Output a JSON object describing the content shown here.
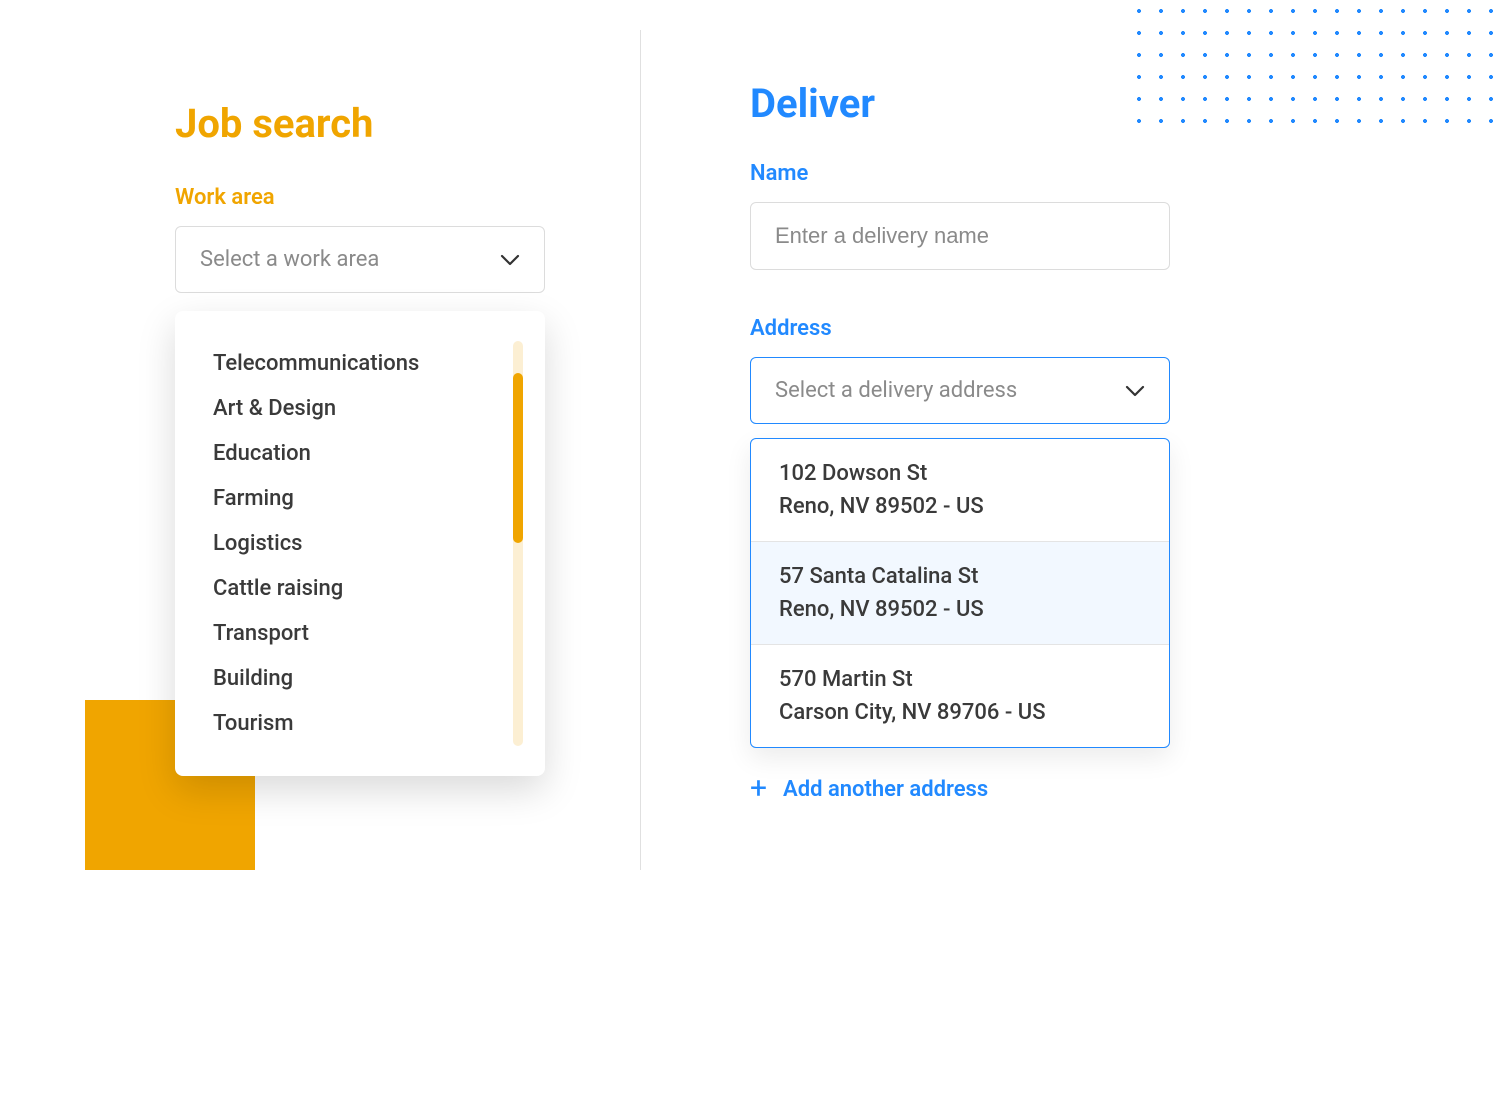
{
  "left": {
    "title": "Job search",
    "work_area_label": "Work area",
    "work_area_placeholder": "Select a work area",
    "options": [
      "Telecommunications",
      "Art & Design",
      "Education",
      "Farming",
      "Logistics",
      "Cattle raising",
      "Transport",
      "Building",
      "Tourism"
    ]
  },
  "right": {
    "title": "Deliver",
    "name_label": "Name",
    "name_placeholder": "Enter a delivery name",
    "address_label": "Address",
    "address_placeholder": "Select a delivery address",
    "addresses": [
      {
        "line1": "102 Dowson St",
        "line2": "Reno, NV 89502 - US",
        "highlight": false
      },
      {
        "line1": "57 Santa Catalina St",
        "line2": "Reno, NV 89502 - US",
        "highlight": true
      },
      {
        "line1": "570 Martin St",
        "line2": "Carson City, NV 89706 - US",
        "highlight": false
      }
    ],
    "add_label": "Add another address"
  },
  "colors": {
    "orange": "#f0a500",
    "blue": "#2189ff"
  }
}
